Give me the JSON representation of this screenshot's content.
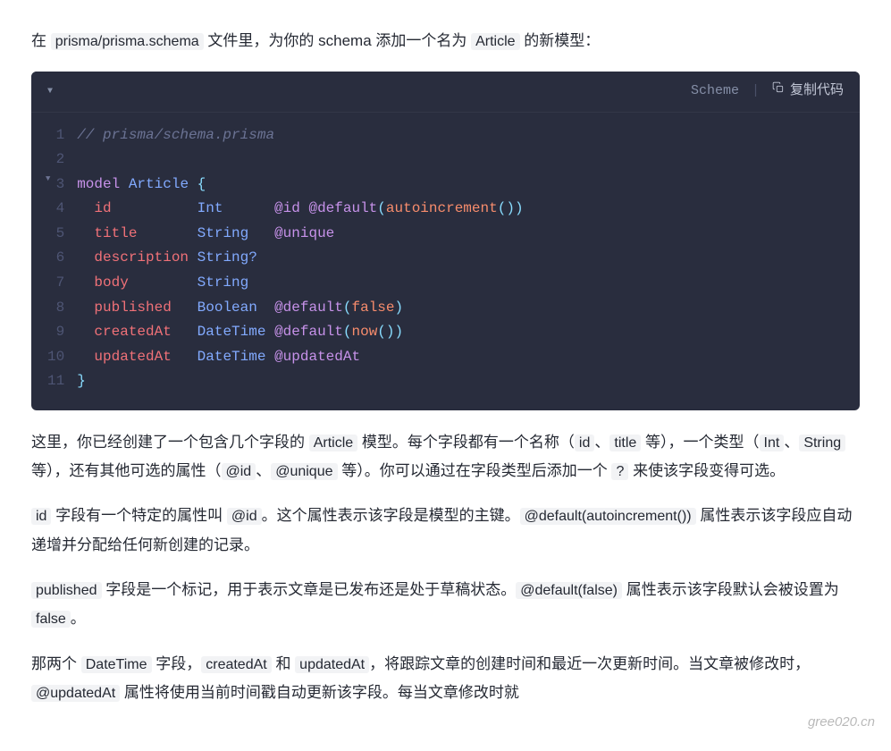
{
  "intro_paragraph": {
    "prefix": "在 ",
    "code1": "prisma/prisma.schema",
    "mid": " 文件里，为你的 schema 添加一个名为 ",
    "code2": "Article",
    "suffix": " 的新模型："
  },
  "code_block": {
    "language": "Scheme",
    "copy_label": "复制代码",
    "lines": [
      {
        "n": 1,
        "fold": false
      },
      {
        "n": 2,
        "fold": false
      },
      {
        "n": 3,
        "fold": true
      },
      {
        "n": 4,
        "fold": false
      },
      {
        "n": 5,
        "fold": false
      },
      {
        "n": 6,
        "fold": false
      },
      {
        "n": 7,
        "fold": false
      },
      {
        "n": 8,
        "fold": false
      },
      {
        "n": 9,
        "fold": false
      },
      {
        "n": 10,
        "fold": false
      },
      {
        "n": 11,
        "fold": false
      }
    ],
    "tokens": {
      "l1_comment": "// prisma/schema.prisma",
      "l3_model": "model",
      "l3_name": "Article",
      "l3_brace": "{",
      "l4_field": "id",
      "l4_type": "Int",
      "l4_at1": "@id",
      "l4_at2": "@default",
      "l4_lp": "(",
      "l4_func": "autoincrement",
      "l4_lp2": "(",
      "l4_rp2": ")",
      "l4_rp": ")",
      "l5_field": "title",
      "l5_type": "String",
      "l5_at": "@unique",
      "l6_field": "description",
      "l6_type": "String?",
      "l7_field": "body",
      "l7_type": "String",
      "l8_field": "published",
      "l8_type": "Boolean",
      "l8_at": "@default",
      "l8_lp": "(",
      "l8_val": "false",
      "l8_rp": ")",
      "l9_field": "createdAt",
      "l9_type": "DateTime",
      "l9_at": "@default",
      "l9_lp": "(",
      "l9_func": "now",
      "l9_lp2": "(",
      "l9_rp2": ")",
      "l9_rp": ")",
      "l10_field": "updatedAt",
      "l10_type": "DateTime",
      "l10_at": "@updatedAt",
      "l11_brace": "}"
    }
  },
  "para2": {
    "t1": "这里，你已经创建了一个包含几个字段的 ",
    "c1": "Article",
    "t2": " 模型。每个字段都有一个名称（",
    "c2": "id",
    "t3": "、",
    "c3": "title",
    "t4": " 等），一个类型（",
    "c4": "Int",
    "t5": "、",
    "c5": "String",
    "t6": " 等），还有其他可选的属性（",
    "c6": "@id",
    "t7": "、",
    "c7": "@unique",
    "t8": " 等）。你可以通过在字段类型后添加一个 ",
    "c8": "?",
    "t9": " 来使该字段变得可选。"
  },
  "para3": {
    "c1": "id",
    "t1": " 字段有一个特定的属性叫 ",
    "c2": "@id",
    "t2": "。这个属性表示该字段是模型的主键。",
    "c3": "@default(autoincrement())",
    "t3": " 属性表示该字段应自动递增并分配给任何新创建的记录。"
  },
  "para4": {
    "c1": "published",
    "t1": " 字段是一个标记，用于表示文章是已发布还是处于草稿状态。",
    "c2": "@default(false)",
    "t2": " 属性表示该字段默认会被设置为 ",
    "c3": "false",
    "t3": "。"
  },
  "para5": {
    "t1": "那两个 ",
    "c1": "DateTime",
    "t2": " 字段，",
    "c2": "createdAt",
    "t3": " 和 ",
    "c3": "updatedAt",
    "t4": "，将跟踪文章的创建时间和最近一次更新时间。当文章被修改时，",
    "c4": "@updatedAt",
    "t5": " 属性将使用当前时间戳自动更新该字段。每当文章修改时就"
  },
  "watermark": "gree020.cn"
}
